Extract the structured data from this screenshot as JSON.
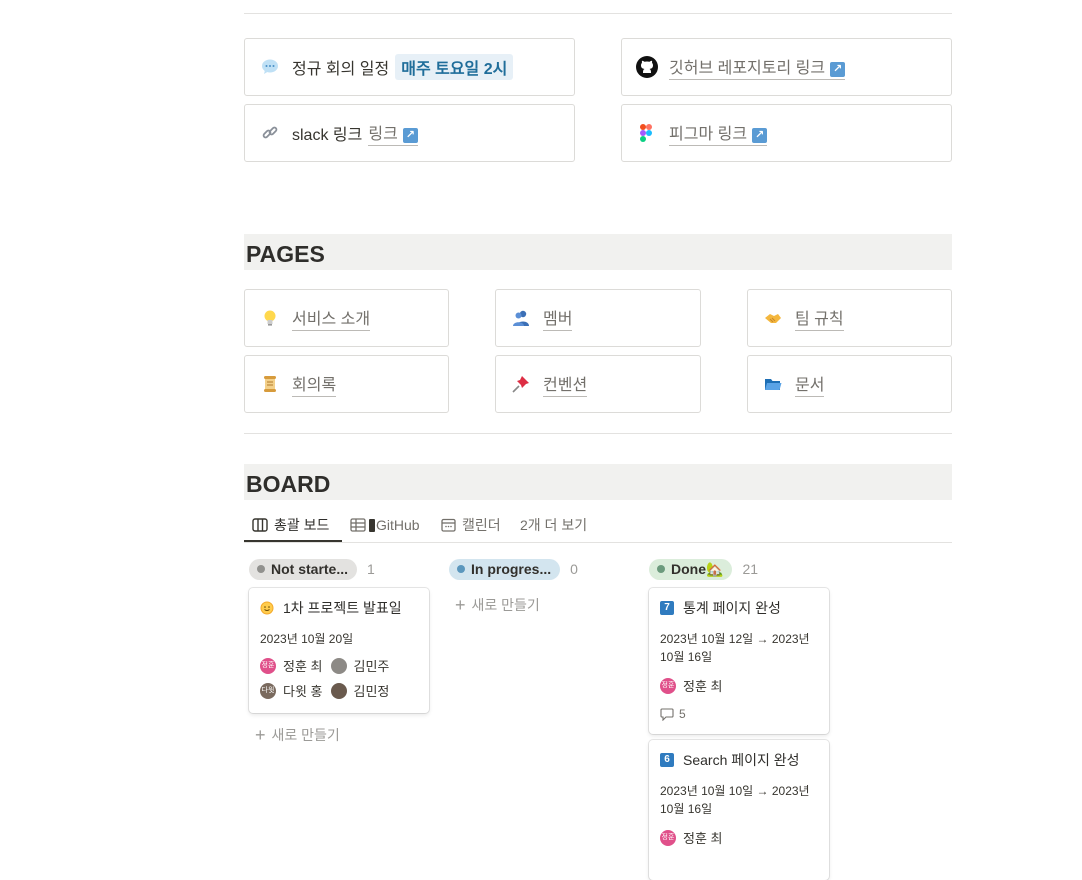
{
  "links": {
    "meeting": {
      "label": "정규 회의 일정",
      "highlight": "매주 토요일 2시"
    },
    "github": {
      "label": "깃허브 레포지토리 링크"
    },
    "slack": {
      "prefix": "slack 링크",
      "link": "링크"
    },
    "figma": {
      "label": "피그마 링크"
    }
  },
  "pages": {
    "heading": "PAGES",
    "items": [
      {
        "label": "서비스 소개",
        "icon": "lightbulb-icon"
      },
      {
        "label": "멤버",
        "icon": "people-icon"
      },
      {
        "label": "팀 규칙",
        "icon": "handshake-icon"
      },
      {
        "label": "회의록",
        "icon": "scroll-icon"
      },
      {
        "label": "컨벤션",
        "icon": "pushpin-icon"
      },
      {
        "label": "문서",
        "icon": "folder-icon"
      }
    ]
  },
  "board": {
    "heading": "BOARD",
    "tabs": [
      {
        "label": "총괄 보드",
        "icon": "board-icon"
      },
      {
        "label": "GitHub",
        "icon": "table-icon"
      },
      {
        "label": "캘린더",
        "icon": "calendar-icon"
      },
      {
        "label": "2개 더 보기"
      }
    ],
    "columns": [
      {
        "status": "Not starte...",
        "count": "1",
        "color": "#91918e",
        "bg": "#e3e2e0"
      },
      {
        "status": "In progres...",
        "count": "0",
        "color": "#5b97bd",
        "bg": "#d3e5ef"
      },
      {
        "status": "Done🏡",
        "count": "21",
        "color": "#6c9b7d",
        "bg": "#dbeddb"
      }
    ],
    "new_label": "새로 만들기",
    "cards": {
      "presentation": {
        "title": "1차 프로젝트 발표일",
        "date": "2023년 10월 20일",
        "people": [
          "정훈 최",
          "김민주",
          "다윗 홍",
          "김민정"
        ]
      },
      "stats": {
        "num": "7",
        "title": "통계 페이지 완성",
        "date": "2023년 10월 12일 → 2023년 10월 16일",
        "person": "정훈 최",
        "comments": "5"
      },
      "search": {
        "num": "6",
        "title": "Search 페이지 완성",
        "date": "2023년 10월 10일 → 2023년 10월 16일",
        "person": "정훈 최"
      }
    }
  },
  "avatars": {
    "jh": "정훈",
    "dw": "다윗"
  }
}
